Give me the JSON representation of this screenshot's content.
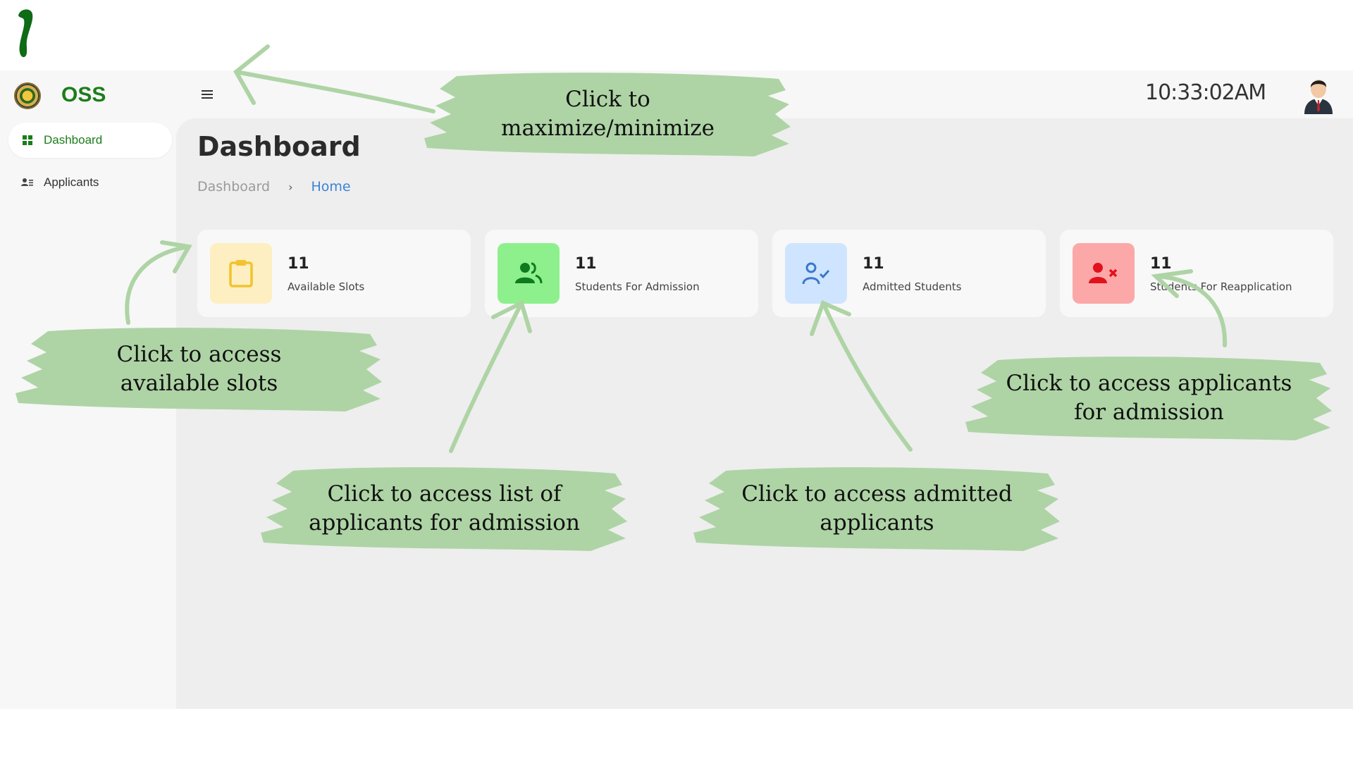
{
  "step": {
    "number": "1"
  },
  "header": {
    "app_name": "OSS",
    "clock": "10:33:02AM"
  },
  "sidebar": {
    "items": [
      {
        "label": "Dashboard",
        "icon": "grid-icon",
        "active": true
      },
      {
        "label": "Applicants",
        "icon": "user-list-icon",
        "active": false
      }
    ]
  },
  "main": {
    "title": "Dashboard",
    "breadcrumb": [
      "Dashboard",
      "Home"
    ]
  },
  "cards": [
    {
      "count": "11",
      "label": "Available Slots",
      "icon": "clipboard-icon",
      "bg": "#fdefc1",
      "fg": "#f2c230"
    },
    {
      "count": "11",
      "label": "Students For Admission",
      "icon": "users-icon",
      "bg": "#8df08d",
      "fg": "#0f7a1e"
    },
    {
      "count": "11",
      "label": "Admitted Students",
      "icon": "user-check-icon",
      "bg": "#cfe4ff",
      "fg": "#3a78c8"
    },
    {
      "count": "11",
      "label": "Students For Reapplication",
      "icon": "user-x-icon",
      "bg": "#fca8a8",
      "fg": "#e3111b"
    }
  ],
  "callouts": {
    "toggle": "Click to maximize/minimize",
    "slots": "Click to access available slots",
    "admission_list": "Click to access list of applicants for admission",
    "admitted": "Click to access admitted applicants",
    "reapplication": "Click to access applicants for admission"
  },
  "colors": {
    "brand_green": "#1b7d1b",
    "callout_green": "#aed4a5",
    "link_blue": "#3c82d8"
  }
}
